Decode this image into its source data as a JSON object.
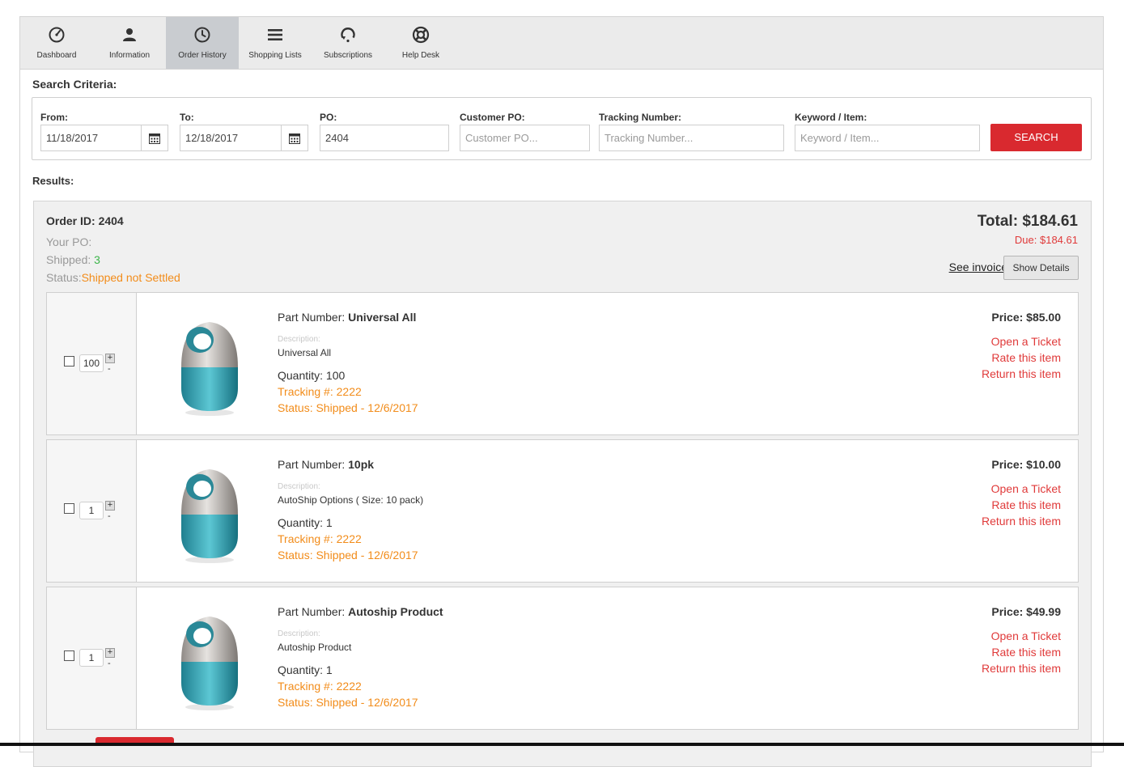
{
  "nav": {
    "tabs": [
      {
        "label": "Dashboard",
        "icon": "dashboard-gauge-icon"
      },
      {
        "label": "Information",
        "icon": "user-icon"
      },
      {
        "label": "Order History",
        "icon": "clock-icon",
        "active": true
      },
      {
        "label": "Shopping Lists",
        "icon": "list-icon"
      },
      {
        "label": "Subscriptions",
        "icon": "refresh-icon"
      },
      {
        "label": "Help Desk",
        "icon": "lifebuoy-icon"
      }
    ]
  },
  "search": {
    "heading": "Search Criteria:",
    "from_label": "From:",
    "from_value": "11/18/2017",
    "to_label": "To:",
    "to_value": "12/18/2017",
    "po_label": "PO:",
    "po_value": "2404",
    "customer_po_label": "Customer PO:",
    "customer_po_placeholder": "Customer PO...",
    "tracking_label": "Tracking Number:",
    "tracking_placeholder": "Tracking Number...",
    "keyword_label": "Keyword / Item:",
    "keyword_placeholder": "Keyword / Item...",
    "button": "SEARCH"
  },
  "results": {
    "heading": "Results:"
  },
  "order": {
    "id_label": "Order ID: 2404",
    "your_po_label": "Your PO:",
    "shipped_label": "Shipped:",
    "shipped_value": "3",
    "status_label": "Status:",
    "status_value": "Shipped not Settled",
    "total": "Total: $184.61",
    "due": "Due: $184.61",
    "see_invoice": "See invoice",
    "show_details": "Show Details",
    "items": [
      {
        "qty_input": "100",
        "part_label": "Part Number: ",
        "part_value": "Universal All",
        "desc_label": "Description:",
        "desc_value": "Universal All",
        "quantity": "Quantity: 100",
        "tracking": "Tracking #: 2222",
        "status": "Status: Shipped - 12/6/2017",
        "price": "Price: $85.00",
        "open_ticket": "Open a Ticket",
        "rate": "Rate this item",
        "return": "Return this item"
      },
      {
        "qty_input": "1",
        "part_label": "Part Number: ",
        "part_value": "10pk",
        "desc_label": "Description:",
        "desc_value": "AutoShip Options ( Size: 10 pack)",
        "quantity": "Quantity: 1",
        "tracking": "Tracking #: 2222",
        "status": "Status: Shipped - 12/6/2017",
        "price": "Price: $10.00",
        "open_ticket": "Open a Ticket",
        "rate": "Rate this item",
        "return": "Return this item"
      },
      {
        "qty_input": "1",
        "part_label": "Part Number: ",
        "part_value": "Autoship Product",
        "desc_label": "Description:",
        "desc_value": "Autoship Product",
        "quantity": "Quantity: 1",
        "tracking": "Tracking #: 2222",
        "status": "Status: Shipped - 12/6/2017",
        "price": "Price: $49.99",
        "open_ticket": "Open a Ticket",
        "rate": "Rate this item",
        "return": "Return this item"
      }
    ]
  },
  "colors": {
    "accent_red": "#d9292f",
    "status_orange": "#f28c1a",
    "shipped_green": "#3cb54a",
    "due_red": "#e03a3a"
  }
}
